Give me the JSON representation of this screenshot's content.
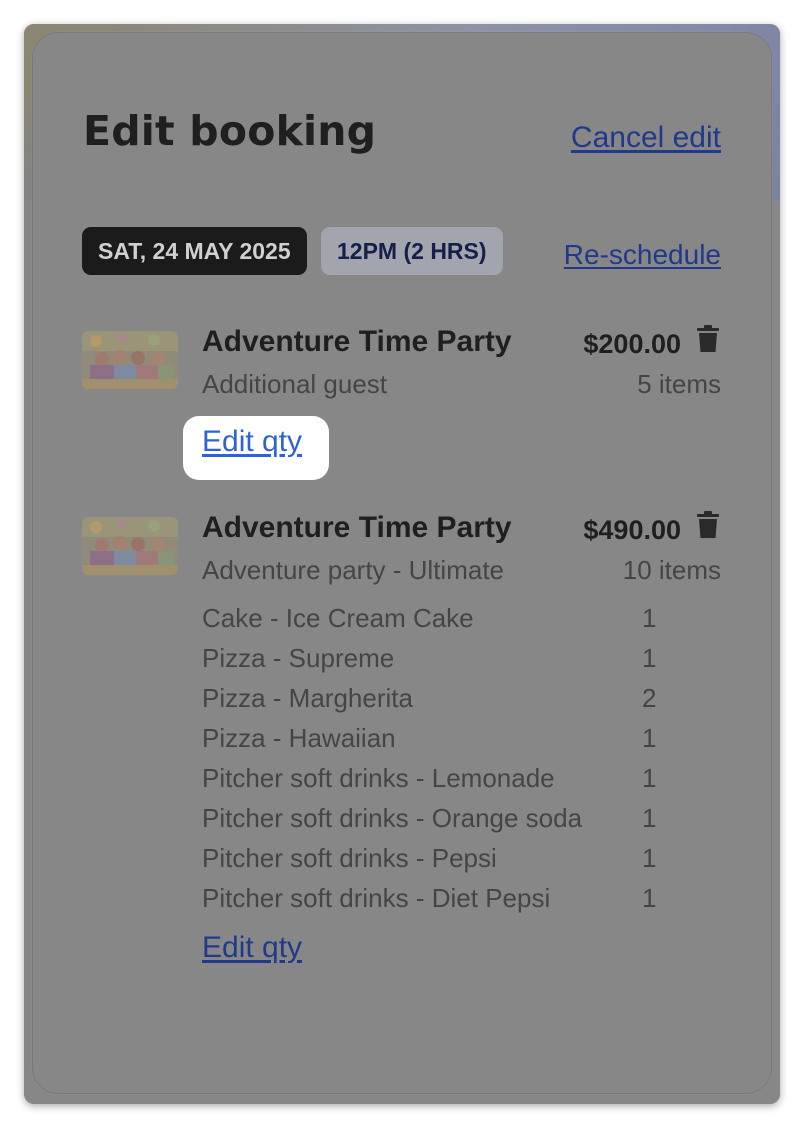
{
  "modal": {
    "title": "Edit booking",
    "cancel_label": "Cancel edit"
  },
  "schedule": {
    "date": "SAT, 24 MAY 2025",
    "time": "12PM (2 HRS)",
    "reschedule_label": "Re-schedule"
  },
  "items": [
    {
      "name": "Adventure Time Party",
      "price": "$200.00",
      "subtitle": "Additional guest",
      "count": "5 items",
      "edit_label": "Edit qty",
      "icon": "trash-icon"
    },
    {
      "name": "Adventure Time Party",
      "price": "$490.00",
      "subtitle": "Adventure party - Ultimate",
      "count": "10 items",
      "edit_label": "Edit qty",
      "icon": "trash-icon",
      "options": [
        {
          "label": "Cake - Ice Cream Cake",
          "qty": "1"
        },
        {
          "label": "Pizza - Supreme",
          "qty": "1"
        },
        {
          "label": "Pizza - Margherita",
          "qty": "2"
        },
        {
          "label": "Pizza - Hawaiian",
          "qty": "1"
        },
        {
          "label": "Pitcher soft drinks - Lemonade",
          "qty": "1"
        },
        {
          "label": "Pitcher soft drinks - Orange soda",
          "qty": "1"
        },
        {
          "label": "Pitcher soft drinks - Pepsi",
          "qty": "1"
        },
        {
          "label": "Pitcher soft drinks - Diet Pepsi",
          "qty": "1"
        }
      ]
    }
  ],
  "colors": {
    "overlay": "#878787",
    "link": "#1f3a8a",
    "highlight_link": "#2f62d6",
    "date_pill_bg": "#1b1b1b",
    "time_pill_bg": "#a2a5ae"
  }
}
